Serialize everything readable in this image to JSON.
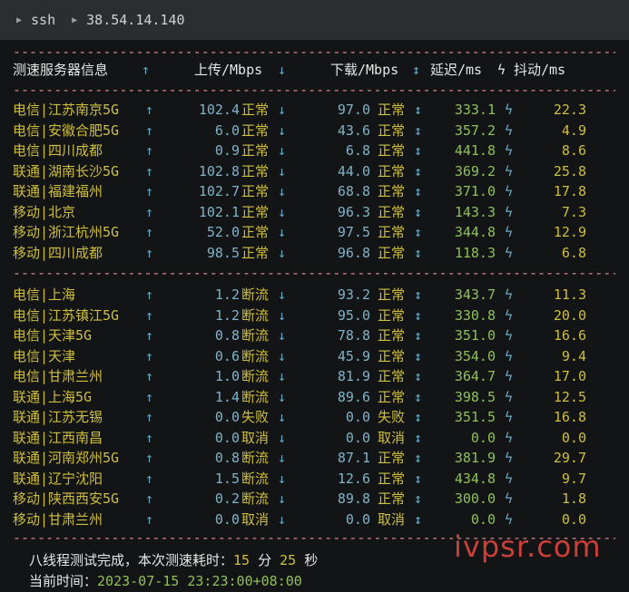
{
  "topbar": {
    "item1": "ssh",
    "item2": "38.54.14.140"
  },
  "separator": "------------------------------------------------------------------------------------------------------------",
  "header": {
    "server": "测速服务器信息",
    "up_arrow": "↑",
    "upload": "上传/Mbps",
    "down_arrow": "↓",
    "download": "下载/Mbps",
    "updown": "↕",
    "latency": "延迟/ms",
    "jitter_icon": "ϟ",
    "jitter": "抖动/ms"
  },
  "group1": [
    {
      "server": "电信|江苏南京5G",
      "up": "102.4",
      "ups": "正常",
      "down": "97.0",
      "downs": "正常",
      "lat": "333.1",
      "jit": "22.3"
    },
    {
      "server": "电信|安徽合肥5G",
      "up": "6.0",
      "ups": "正常",
      "down": "43.6",
      "downs": "正常",
      "lat": "357.2",
      "jit": "4.9"
    },
    {
      "server": "电信|四川成都",
      "up": "0.9",
      "ups": "正常",
      "down": "6.8",
      "downs": "正常",
      "lat": "441.8",
      "jit": "8.6"
    },
    {
      "server": "联通|湖南长沙5G",
      "up": "102.8",
      "ups": "正常",
      "down": "44.0",
      "downs": "正常",
      "lat": "369.2",
      "jit": "25.8"
    },
    {
      "server": "联通|福建福州",
      "up": "102.7",
      "ups": "正常",
      "down": "68.8",
      "downs": "正常",
      "lat": "371.0",
      "jit": "17.8"
    },
    {
      "server": "移动|北京",
      "up": "102.1",
      "ups": "正常",
      "down": "96.3",
      "downs": "正常",
      "lat": "143.3",
      "jit": "7.3"
    },
    {
      "server": "移动|浙江杭州5G",
      "up": "52.0",
      "ups": "正常",
      "down": "97.5",
      "downs": "正常",
      "lat": "344.8",
      "jit": "12.9"
    },
    {
      "server": "移动|四川成都",
      "up": "98.5",
      "ups": "正常",
      "down": "96.8",
      "downs": "正常",
      "lat": "118.3",
      "jit": "6.8"
    }
  ],
  "group2": [
    {
      "server": "电信|上海",
      "up": "1.2",
      "ups": "断流",
      "down": "93.2",
      "downs": "正常",
      "lat": "343.7",
      "jit": "11.3"
    },
    {
      "server": "电信|江苏镇江5G",
      "up": "1.2",
      "ups": "断流",
      "down": "95.0",
      "downs": "正常",
      "lat": "330.8",
      "jit": "20.0"
    },
    {
      "server": "电信|天津5G",
      "up": "0.8",
      "ups": "断流",
      "down": "78.8",
      "downs": "正常",
      "lat": "351.0",
      "jit": "16.6"
    },
    {
      "server": "电信|天津",
      "up": "0.6",
      "ups": "断流",
      "down": "45.9",
      "downs": "正常",
      "lat": "354.0",
      "jit": "9.4"
    },
    {
      "server": "电信|甘肃兰州",
      "up": "1.0",
      "ups": "断流",
      "down": "81.9",
      "downs": "正常",
      "lat": "364.7",
      "jit": "17.0"
    },
    {
      "server": "联通|上海5G",
      "up": "1.4",
      "ups": "断流",
      "down": "89.6",
      "downs": "正常",
      "lat": "398.5",
      "jit": "12.5"
    },
    {
      "server": "联通|江苏无锡",
      "up": "0.0",
      "ups": "失败",
      "down": "0.0",
      "downs": "失败",
      "lat": "351.5",
      "jit": "16.8"
    },
    {
      "server": "联通|江西南昌",
      "up": "0.0",
      "ups": "取消",
      "down": "0.0",
      "downs": "取消",
      "lat": "0.0",
      "jit": "0.0"
    },
    {
      "server": "联通|河南郑州5G",
      "up": "0.8",
      "ups": "断流",
      "down": "87.1",
      "downs": "正常",
      "lat": "381.9",
      "jit": "29.7"
    },
    {
      "server": "联通|辽宁沈阳",
      "up": "1.5",
      "ups": "断流",
      "down": "12.6",
      "downs": "正常",
      "lat": "434.8",
      "jit": "9.7"
    },
    {
      "server": "移动|陕西西安5G",
      "up": "0.2",
      "ups": "断流",
      "down": "89.8",
      "downs": "正常",
      "lat": "300.0",
      "jit": "1.8"
    },
    {
      "server": "移动|甘肃兰州",
      "up": "0.0",
      "ups": "取消",
      "down": "0.0",
      "downs": "取消",
      "lat": "0.0",
      "jit": "0.0"
    }
  ],
  "footer": {
    "line1_prefix": "八线程测试完成，本次测速耗时：",
    "minutes": "15",
    "min_unit": "分",
    "seconds": "25",
    "sec_unit": "秒",
    "line2_prefix": "当前时间：",
    "time": "2023-07-15 23:23:00+08:00"
  },
  "watermark": "ivpsr.com",
  "icons": {
    "up": "arrow-up-icon",
    "down": "arrow-down-icon",
    "updown": "arrow-updown-icon",
    "jitter": "lightning-icon"
  },
  "colors": {
    "server": "#cfbf3f",
    "speed": "#7fb3c9",
    "latency": "#8fc05a",
    "separator": "#d98a8a",
    "watermark": "#e0443a"
  }
}
